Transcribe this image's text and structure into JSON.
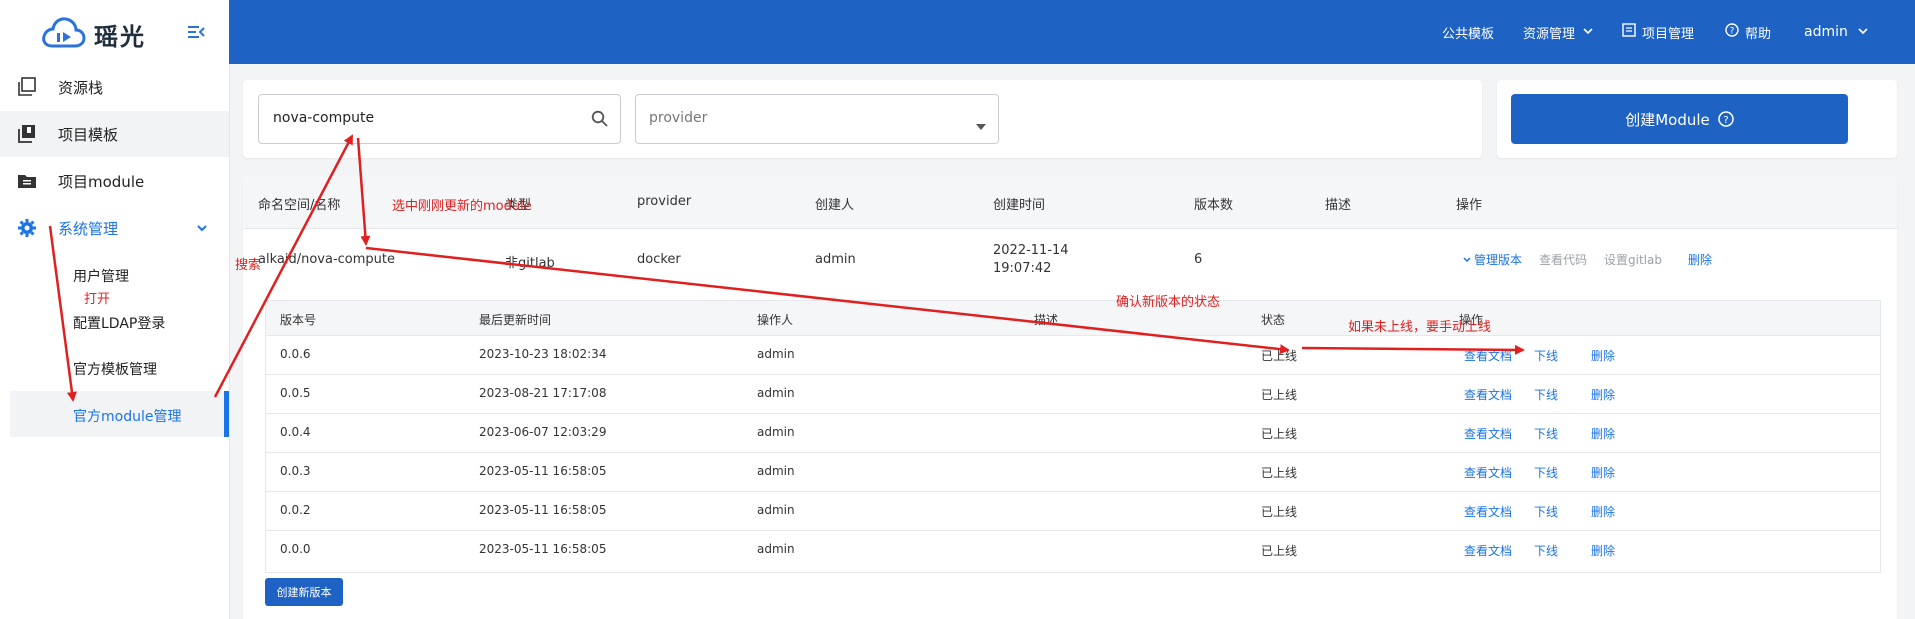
{
  "brand": {
    "name": "瑶光",
    "logo_icon": "cloud-icon"
  },
  "sidebar": {
    "items": [
      {
        "label": "资源栈",
        "icon": "stack-icon"
      },
      {
        "label": "项目模板",
        "icon": "template-icon"
      },
      {
        "label": "项目module",
        "icon": "folder-icon"
      },
      {
        "label": "系统管理",
        "icon": "gear-icon"
      }
    ],
    "sub_items": [
      {
        "label": "用户管理"
      },
      {
        "label": "配置LDAP登录"
      },
      {
        "label": "官方模板管理"
      },
      {
        "label": "官方module管理"
      }
    ]
  },
  "header": {
    "nav": [
      {
        "label": "公共模板"
      },
      {
        "label": "资源管理"
      },
      {
        "label": "项目管理"
      },
      {
        "label": "帮助"
      },
      {
        "label": "admin"
      }
    ]
  },
  "filters": {
    "search_value": "nova-compute",
    "provider_placeholder": "provider",
    "create_button": "创建Module"
  },
  "table": {
    "columns": [
      "命名空间/名称",
      "类型",
      "provider",
      "创建人",
      "创建时间",
      "版本数",
      "描述",
      "操作"
    ],
    "row": {
      "name": "alkaid/nova-compute",
      "type": "非gitlab",
      "provider": "docker",
      "creator": "admin",
      "created_date": "2022-11-14",
      "created_time": "19:07:42",
      "versions": "6",
      "description": "",
      "actions": [
        "管理版本",
        "查看代码",
        "设置gitlab",
        "删除"
      ]
    }
  },
  "versions": {
    "columns": [
      "版本号",
      "最后更新时间",
      "操作人",
      "描述",
      "状态",
      "操作"
    ],
    "rows": [
      {
        "version": "0.0.6",
        "updated": "2023-10-23 18:02:34",
        "operator": "admin",
        "desc": "",
        "status": "已上线"
      },
      {
        "version": "0.0.5",
        "updated": "2023-08-21 17:17:08",
        "operator": "admin",
        "desc": "",
        "status": "已上线"
      },
      {
        "version": "0.0.4",
        "updated": "2023-06-07 12:03:29",
        "operator": "admin",
        "desc": "",
        "status": "已上线"
      },
      {
        "version": "0.0.3",
        "updated": "2023-05-11 16:58:05",
        "operator": "admin",
        "desc": "",
        "status": "已上线"
      },
      {
        "version": "0.0.2",
        "updated": "2023-05-11 16:58:05",
        "operator": "admin",
        "desc": "",
        "status": "已上线"
      },
      {
        "version": "0.0.0",
        "updated": "2023-05-11 16:58:05",
        "operator": "admin",
        "desc": "",
        "status": "已上线"
      }
    ],
    "row_actions": [
      "查看文档",
      "下线",
      "删除"
    ],
    "create_button": "创建新版本"
  },
  "annotations": {
    "search": "搜索",
    "open": "打开",
    "select": "选中刚刚更新的module",
    "confirm": "确认新版本的状态",
    "manual": "如果未上线，要手动上线"
  },
  "colors": {
    "primary": "#1e63c4",
    "link": "#1a73e8",
    "annotation": "#e02020"
  }
}
